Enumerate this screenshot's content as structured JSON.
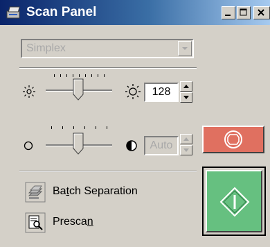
{
  "window": {
    "title": "Scan Panel",
    "titlebar_icon": "scanner-icon",
    "controls": [
      "minimize-icon",
      "maximize-icon",
      "close-icon"
    ]
  },
  "scan_mode": {
    "selected": "Simplex",
    "enabled": false
  },
  "brightness": {
    "icon_low": "sun-small-icon",
    "icon_high": "sun-large-icon",
    "value": "128",
    "level": 0.5
  },
  "contrast": {
    "icon_low": "circle-outline-icon",
    "icon_high": "half-circle-icon",
    "value": "Auto",
    "enabled": false,
    "level": 0.5
  },
  "actions": {
    "batch_separation": {
      "pre": "Ba",
      "ul": "t",
      "post": "ch Separation",
      "icon": "batch-separation-icon",
      "enabled": false
    },
    "prescan": {
      "pre": "Presca",
      "ul": "n",
      "post": "",
      "icon": "prescan-icon"
    }
  },
  "buttons": {
    "stop": {
      "icon": "stop-icon"
    },
    "start": {
      "icon": "start-diamond-icon"
    }
  },
  "colors": {
    "stop_button": "#e07060",
    "start_button": "#66c080",
    "title_bar": "#0a246a"
  }
}
